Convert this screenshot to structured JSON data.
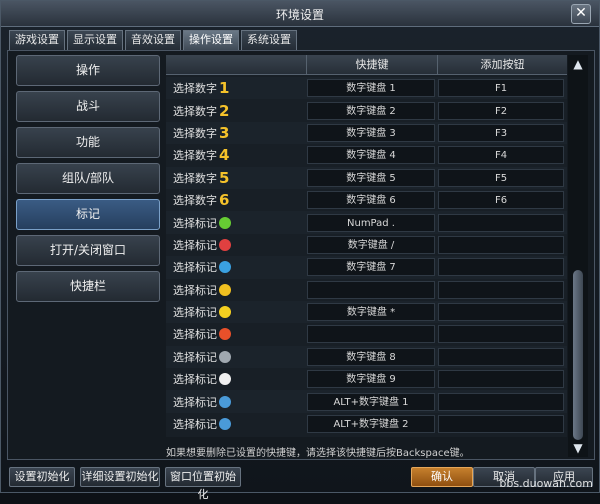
{
  "window": {
    "title": "环境设置",
    "close_glyph": "✕"
  },
  "tabs": [
    {
      "label": "游戏设置"
    },
    {
      "label": "显示设置"
    },
    {
      "label": "音效设置"
    },
    {
      "label": "操作设置",
      "active": true
    },
    {
      "label": "系统设置"
    }
  ],
  "sidebar": {
    "items": [
      {
        "label": "操作"
      },
      {
        "label": "战斗"
      },
      {
        "label": "功能"
      },
      {
        "label": "组队/部队"
      },
      {
        "label": "标记",
        "active": true
      },
      {
        "label": "打开/关闭窗口"
      },
      {
        "label": "快捷栏"
      }
    ]
  },
  "table": {
    "headers": [
      "",
      "快捷键",
      "添加按钮"
    ],
    "rows": [
      {
        "label": "选择数字",
        "num": "1",
        "shortcut": "数字键盘 1",
        "add": "F1"
      },
      {
        "label": "选择数字",
        "num": "2",
        "shortcut": "数字键盘 2",
        "add": "F2"
      },
      {
        "label": "选择数字",
        "num": "3",
        "shortcut": "数字键盘 3",
        "add": "F3"
      },
      {
        "label": "选择数字",
        "num": "4",
        "shortcut": "数字键盘 4",
        "add": "F4"
      },
      {
        "label": "选择数字",
        "num": "5",
        "shortcut": "数字键盘 5",
        "add": "F5"
      },
      {
        "label": "选择数字",
        "num": "6",
        "shortcut": "数字键盘 6",
        "add": "F6"
      },
      {
        "label": "选择标记",
        "icon": "sleep-icon",
        "color": "#66cc33",
        "shortcut": "NumPad .",
        "add": ""
      },
      {
        "label": "选择标记",
        "icon": "prohibited-icon",
        "color": "#e04040",
        "shortcut": "数字键盘 /",
        "add": ""
      },
      {
        "label": "选择标记",
        "icon": "arrow-down-icon",
        "color": "#3aa0e0",
        "shortcut": "数字键盘 7",
        "add": ""
      },
      {
        "label": "选择标记",
        "icon": "smiley-icon",
        "color": "#f0c020",
        "shortcut": "",
        "add": ""
      },
      {
        "label": "选择标记",
        "icon": "star-icon",
        "color": "#f5d020",
        "shortcut": "数字键盘 *",
        "add": ""
      },
      {
        "label": "选择标记",
        "icon": "heart-icon",
        "color": "#e8502a",
        "shortcut": "",
        "add": ""
      },
      {
        "label": "选择标记",
        "icon": "bomb-icon",
        "color": "#a0a8b0",
        "shortcut": "数字键盘 8",
        "add": ""
      },
      {
        "label": "选择标记",
        "icon": "skull-icon",
        "color": "#f0f0f0",
        "shortcut": "数字键盘 9",
        "add": ""
      },
      {
        "label": "选择标记",
        "icon": "shield-1-icon",
        "color": "#4a9ad8",
        "shortcut": "ALT+数字键盘 1",
        "add": ""
      },
      {
        "label": "选择标记",
        "icon": "shield-2-icon",
        "color": "#4a9ad8",
        "shortcut": "ALT+数字键盘 2",
        "add": ""
      }
    ]
  },
  "hint": "如果想要删除已设置的快捷键，请选择该快捷键后按Backspace键。",
  "footer": {
    "reset_label": "设置初始化",
    "detail_reset_label": "详细设置初始化",
    "window_pos_reset_label": "窗口位置初始化",
    "confirm_label": "确认",
    "cancel_label": "取消",
    "apply_label": "应用"
  },
  "watermark": "bbs.duowan.com"
}
